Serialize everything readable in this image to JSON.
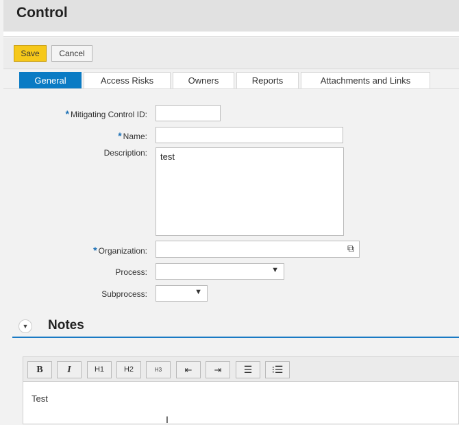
{
  "header": {
    "title": "Control"
  },
  "toolbar": {
    "save_label": "Save",
    "cancel_label": "Cancel"
  },
  "tabs": [
    {
      "label": "General",
      "active": true
    },
    {
      "label": "Access Risks"
    },
    {
      "label": "Owners"
    },
    {
      "label": "Reports"
    },
    {
      "label": "Attachments and Links"
    }
  ],
  "form": {
    "mitigating_control_id": {
      "label": "Mitigating Control ID:",
      "value": "",
      "required": true
    },
    "name": {
      "label": "Name:",
      "value": "",
      "required": true
    },
    "description": {
      "label": "Description:",
      "value": "test"
    },
    "organization": {
      "label": "Organization:",
      "value": "",
      "required": true
    },
    "process": {
      "label": "Process:",
      "value": ""
    },
    "subprocess": {
      "label": "Subprocess:",
      "value": ""
    },
    "required_marker": "*"
  },
  "notes": {
    "title": "Notes",
    "content": "Test",
    "toolbar": [
      "B",
      "I",
      "H1",
      "H2",
      "H3",
      "outdent",
      "indent",
      "numbered-list",
      "bullet-list"
    ],
    "labels": {
      "bold": "B",
      "italic": "I",
      "h1": "H1",
      "h2": "H2",
      "h3": "H3"
    }
  },
  "colors": {
    "accent": "#0a7bc4",
    "save": "#f6c81a"
  }
}
